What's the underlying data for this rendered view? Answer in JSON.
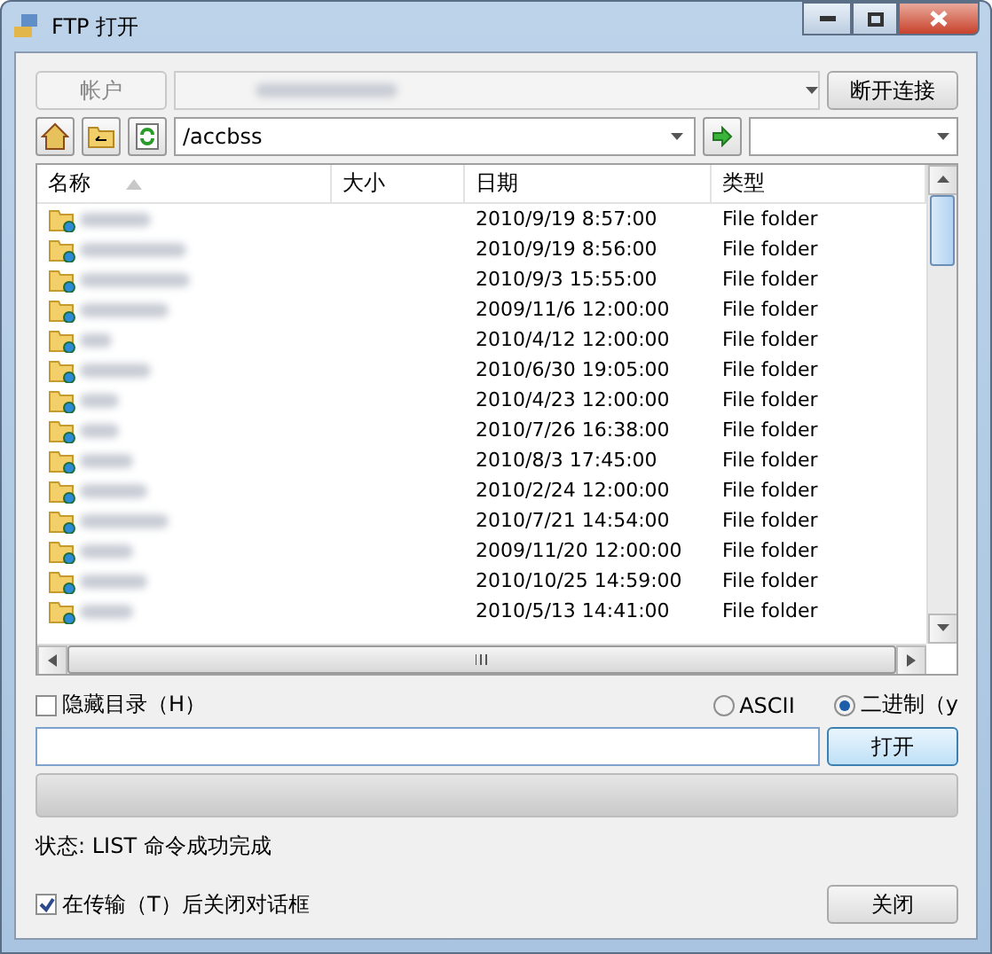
{
  "window": {
    "title": "FTP 打开"
  },
  "account": {
    "label": "帐户",
    "disconnect": "断开连接"
  },
  "path": {
    "value": "/accbss"
  },
  "table": {
    "columns": [
      {
        "label": "名称",
        "sorted": true
      },
      {
        "label": "大小",
        "sorted": false
      },
      {
        "label": "日期",
        "sorted": false
      },
      {
        "label": "类型",
        "sorted": false
      }
    ],
    "rows": [
      {
        "date": "2010/9/19 8:57:00",
        "type": "File folder"
      },
      {
        "date": "2010/9/19 8:56:00",
        "type": "File folder"
      },
      {
        "date": "2010/9/3 15:55:00",
        "type": "File folder"
      },
      {
        "date": "2009/11/6 12:00:00",
        "type": "File folder"
      },
      {
        "date": "2010/4/12 12:00:00",
        "type": "File folder"
      },
      {
        "date": "2010/6/30 19:05:00",
        "type": "File folder"
      },
      {
        "date": "2010/4/23 12:00:00",
        "type": "File folder"
      },
      {
        "date": "2010/7/26 16:38:00",
        "type": "File folder"
      },
      {
        "date": "2010/8/3 17:45:00",
        "type": "File folder"
      },
      {
        "date": "2010/2/24 12:00:00",
        "type": "File folder"
      },
      {
        "date": "2010/7/21 14:54:00",
        "type": "File folder"
      },
      {
        "date": "2009/11/20 12:00:00",
        "type": "File folder"
      },
      {
        "date": "2010/10/25 14:59:00",
        "type": "File folder"
      },
      {
        "date": "2010/5/13 14:41:00",
        "type": "File folder"
      }
    ]
  },
  "hide_dirs": {
    "label": "隐藏目录（H）",
    "checked": false
  },
  "modes": [
    {
      "label": "ASCII",
      "selected": false
    },
    {
      "label": "二进制（y",
      "selected": true
    }
  ],
  "open_button": "打开",
  "progress": {
    "level": 0
  },
  "status": "状态: LIST 命令成功完成",
  "close_after": {
    "label": "在传输（T）后关闭对话框",
    "checked": true
  },
  "close_button": "关闭"
}
